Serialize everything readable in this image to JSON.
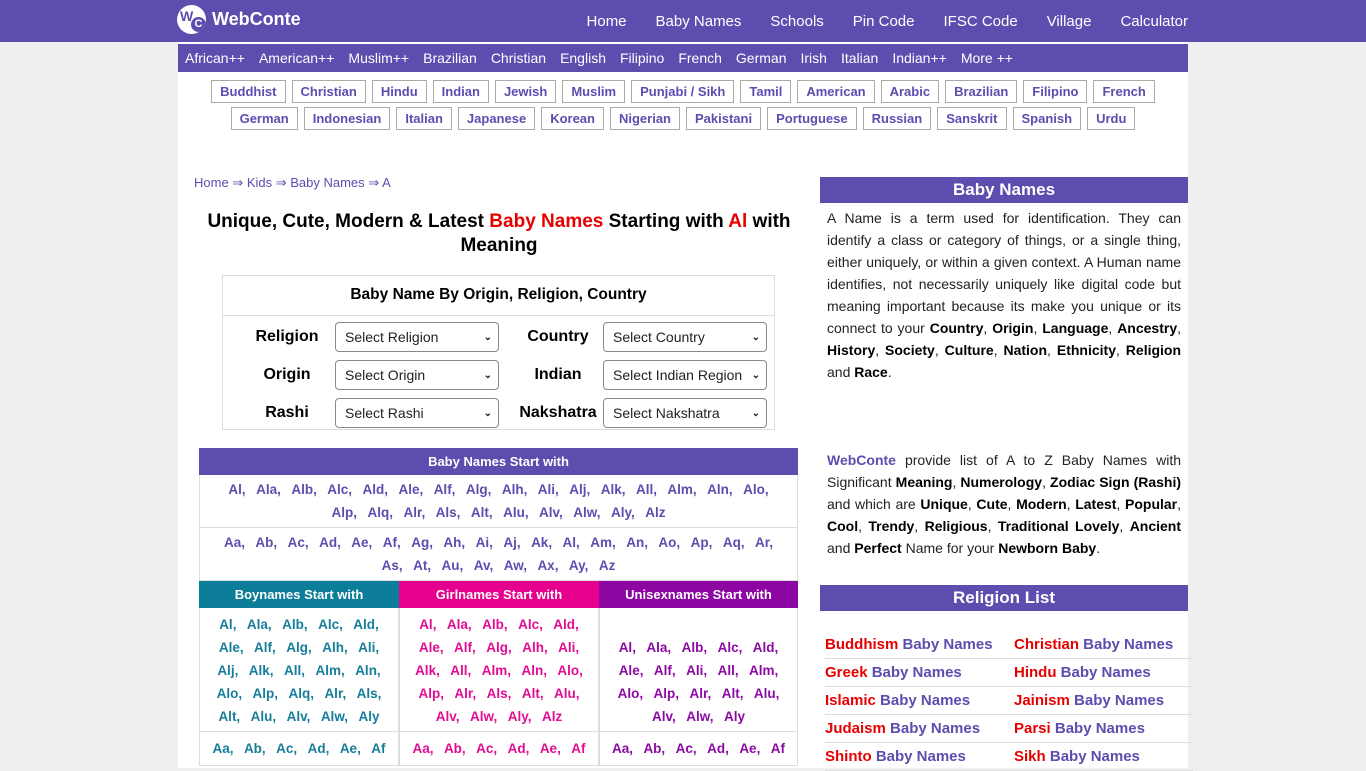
{
  "header": {
    "brand": "WebConte",
    "logo_letters": {
      "w": "W",
      "c": "C"
    },
    "nav": [
      "Home",
      "Baby Names",
      "Schools",
      "Pin Code",
      "IFSC Code",
      "Village",
      "Calculator"
    ]
  },
  "subnav": [
    "African++",
    "American++",
    "Muslim++",
    "Brazilian",
    "Christian",
    "English",
    "Filipino",
    "French",
    "German",
    "Irish",
    "Italian",
    "Indian++",
    "More ++"
  ],
  "tags": {
    "row1": [
      "Buddhist",
      "Christian",
      "Hindu",
      "Indian",
      "Jewish",
      "Muslim",
      "Punjabi / Sikh",
      "Tamil",
      "American",
      "Arabic",
      "Brazilian",
      "Filipino",
      "French"
    ],
    "row2": [
      "German",
      "Indonesian",
      "Italian",
      "Japanese",
      "Korean",
      "Nigerian",
      "Pakistani",
      "Portuguese",
      "Russian",
      "Sanskrit",
      "Spanish",
      "Urdu"
    ]
  },
  "breadcrumb": {
    "items": [
      "Home",
      "Kids",
      "Baby Names",
      "A"
    ],
    "separator": "⇒"
  },
  "title": {
    "part1": "Unique, Cute, Modern & Latest ",
    "highlight1": "Baby Names",
    "part2": " Starting with ",
    "highlight2": "Al",
    "part3": " with Meaning"
  },
  "filter": {
    "heading": "Baby Name By Origin, Religion, Country",
    "fields": [
      {
        "label": "Religion",
        "value": "Select Religion"
      },
      {
        "label": "Country",
        "value": "Select Country"
      },
      {
        "label": "Origin",
        "value": "Select Origin"
      },
      {
        "label": "Indian",
        "value": "Select Indian Region"
      },
      {
        "label": "Rashi",
        "value": "Select Rashi"
      },
      {
        "label": "Nakshatra",
        "value": "Select Nakshatra"
      }
    ]
  },
  "start_with": {
    "heading": "Baby Names Start with",
    "al_list": [
      "Al",
      "Ala",
      "Alb",
      "Alc",
      "Ald",
      "Ale",
      "Alf",
      "Alg",
      "Alh",
      "Ali",
      "Alj",
      "Alk",
      "All",
      "Alm",
      "Aln",
      "Alo",
      "Alp",
      "Alq",
      "Alr",
      "Als",
      "Alt",
      "Alu",
      "Alv",
      "Alw",
      "Aly",
      "Alz"
    ],
    "a_list": [
      "Aa",
      "Ab",
      "Ac",
      "Ad",
      "Ae",
      "Af",
      "Ag",
      "Ah",
      "Ai",
      "Aj",
      "Ak",
      "Al",
      "Am",
      "An",
      "Ao",
      "Ap",
      "Aq",
      "Ar",
      "As",
      "At",
      "Au",
      "Av",
      "Aw",
      "Ax",
      "Ay",
      "Az"
    ]
  },
  "gender_tables": {
    "boy": {
      "heading": "Boynames Start with",
      "al": [
        "Al",
        "Ala",
        "Alb",
        "Alc",
        "Ald",
        "Ale",
        "Alf",
        "Alg",
        "Alh",
        "Ali",
        "Alj",
        "Alk",
        "All",
        "Alm",
        "Aln",
        "Alo",
        "Alp",
        "Alq",
        "Alr",
        "Als",
        "Alt",
        "Alu",
        "Alv",
        "Alw",
        "Aly"
      ],
      "a": [
        "Aa",
        "Ab",
        "Ac",
        "Ad",
        "Ae",
        "Af"
      ]
    },
    "girl": {
      "heading": "Girlnames Start with",
      "al": [
        "Al",
        "Ala",
        "Alb",
        "Alc",
        "Ald",
        "Ale",
        "Alf",
        "Alg",
        "Alh",
        "Ali",
        "Alk",
        "All",
        "Alm",
        "Aln",
        "Alo",
        "Alp",
        "Alr",
        "Als",
        "Alt",
        "Alu",
        "Alv",
        "Alw",
        "Aly",
        "Alz"
      ],
      "a": [
        "Aa",
        "Ab",
        "Ac",
        "Ad",
        "Ae",
        "Af"
      ]
    },
    "unisex": {
      "heading": "Unisexnames Start with",
      "al": [
        "Al",
        "Ala",
        "Alb",
        "Alc",
        "Ald",
        "Ale",
        "Alf",
        "Ali",
        "All",
        "Alm",
        "Alo",
        "Alp",
        "Alr",
        "Alt",
        "Alu",
        "Alv",
        "Alw",
        "Aly"
      ],
      "a": [
        "Aa",
        "Ab",
        "Ac",
        "Ad",
        "Ae",
        "Af"
      ]
    }
  },
  "sidebar": {
    "baby_names_heading": "Baby Names",
    "para1_html": "A Name is a term used for identification. They can identify a class or category of things, or a single thing, either uniquely, or within a given context. A Human name identifies, not necessarily uniquely like digital code but meaning important because its make you unique or its connect to your <b>Country</b>, <b>Origin</b>, <b>Language</b>, <b>Ancestry</b>, <b>History</b>, <b>Society</b>, <b>Culture</b>, <b>Nation</b>, <b>Ethnicity</b>, <b>Religion</b> and <b>Race</b>.",
    "para2_html": "<b style=\"color:#5b4eaf\">WebConte</b> provide list of A to Z Baby Names with Significant <b>Meaning</b>, <b>Numerology</b>, <b>Zodiac Sign (Rashi)</b> and which are <b>Unique</b>, <b>Cute</b>, <b>Modern</b>, <b>Latest</b>, <b>Popular</b>, <b>Cool</b>, <b>Trendy</b>, <b>Religious</b>, <b>Traditional Lovely</b>, <b>Ancient</b> and <b>Perfect</b> Name for your <b>Newborn Baby</b>.",
    "religion_heading": "Religion List",
    "religion_suffix": " Baby Names",
    "religions": [
      "Buddhism",
      "Christian",
      "Greek",
      "Hindu",
      "Islamic",
      "Jainism",
      "Judaism",
      "Parsi",
      "Shinto",
      "Sikh"
    ]
  },
  "colors": {
    "brand": "#5b4eaf",
    "highlight": "#e60000",
    "boy": "#0c7e9a",
    "girl": "#e6008e",
    "unisex": "#8d05a3"
  }
}
